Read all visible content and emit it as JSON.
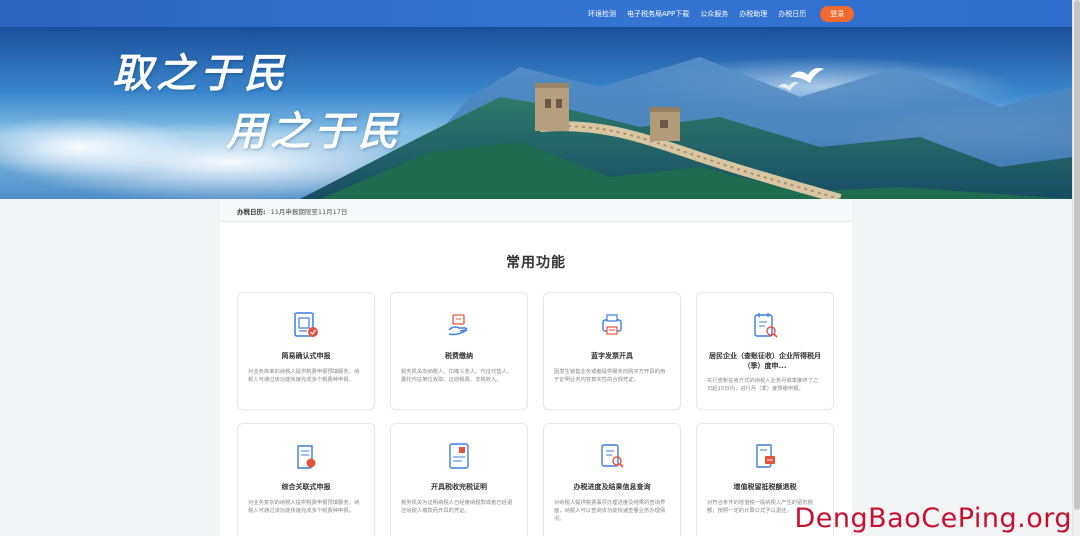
{
  "nav": {
    "items": [
      "环境检测",
      "电子税务局APP下载",
      "公众服务",
      "办税助理",
      "办税日历"
    ],
    "login": "登录"
  },
  "hero": {
    "line1": "取之于民",
    "line2": "用之于民"
  },
  "calendar": {
    "label": "办税日历:",
    "text": "11月申报期限至11月17日"
  },
  "section_title": "常用功能",
  "cards": [
    {
      "title": "简易确认式申报",
      "desc": "对业务简单的纳税人提供税费申报预填服务，纳税人可通过该功能快速完成多个税费种申报。",
      "icon": "simple-declare-icon"
    },
    {
      "title": "税费缴纳",
      "desc": "税务机关向纳税人、扣缴义务人、代征代售人、委托代征单位收取、征收税费、非税收入。",
      "icon": "tax-payment-icon"
    },
    {
      "title": "蓝字发票开具",
      "desc": "因发生销售业务或者提供服务向购买方开具的用于证明业务内容真实性的合规凭证。",
      "icon": "invoice-icon"
    },
    {
      "title": "居民企业（查账征收）企业所得税月（季）度申...",
      "desc": "实行查账征收方式的纳税人业务月或季度终了之日起15日内，进行月（季）度预缴申报。",
      "icon": "enterprise-tax-icon"
    },
    {
      "title": "综合关联式申报",
      "desc": "对业务复杂的纳税人提供税费申报预填服务，纳税人可通过该功能快速完成多个税费种申报。",
      "icon": "combined-declare-icon"
    },
    {
      "title": "开具税收完税证明",
      "desc": "税务机关为证明纳税人已经缴纳税款或者已经退还纳税人缴款而开具的凭证。",
      "icon": "tax-certificate-icon"
    },
    {
      "title": "办税进度及结果信息查询",
      "desc": "对纳税人提供税费事项办理进度及结果的查询界面，纳税人可以查询该功能快速查看业务办理情况。",
      "icon": "progress-query-icon"
    },
    {
      "title": "增值税留抵税额退税",
      "desc": "对符合条件的增值税一般纳税人产生的留抵税额，按照一定的计算公式予以退还。",
      "icon": "vat-refund-icon"
    }
  ],
  "watermark": "DengBaoCePing.org",
  "colors": {
    "accent": "#3474d2",
    "login": "#f26a2e",
    "icon_blue": "#3b7de0",
    "icon_red": "#e5533d"
  }
}
